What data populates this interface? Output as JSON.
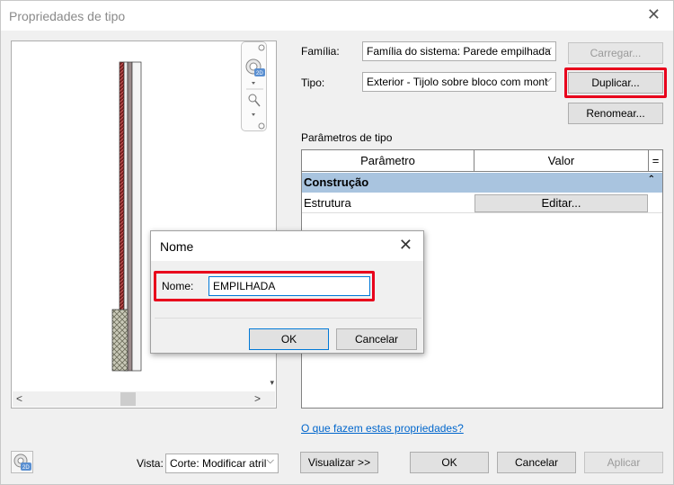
{
  "window": {
    "title": "Propriedades de tipo",
    "close_glyph": "✕"
  },
  "family": {
    "label": "Família:",
    "value": "Família do sistema: Parede empilhada"
  },
  "type": {
    "label": "Tipo:",
    "value": "Exterior - Tijolo sobre bloco com mont"
  },
  "buttons": {
    "load": "Carregar...",
    "duplicate": "Duplicar...",
    "rename": "Renomear...",
    "preview": "Visualizar >>",
    "ok": "OK",
    "cancel": "Cancelar",
    "apply": "Aplicar"
  },
  "params": {
    "title": "Parâmetros de tipo",
    "columns": [
      "Parâmetro",
      "Valor",
      "="
    ],
    "group": "Construção",
    "rows": [
      {
        "name": "Estrutura",
        "value": "Editar..."
      }
    ]
  },
  "help_link": "O que fazem estas propriedades?",
  "view": {
    "label": "Vista:",
    "value": "Corte: Modificar atril"
  },
  "dialog": {
    "title": "Nome",
    "field_label": "Nome:",
    "field_value": "EMPILHADA",
    "ok": "OK",
    "cancel": "Cancelar"
  },
  "colors": {
    "highlight": "#e8001c",
    "group_band": "#a9c4df",
    "link": "#0066cc"
  }
}
